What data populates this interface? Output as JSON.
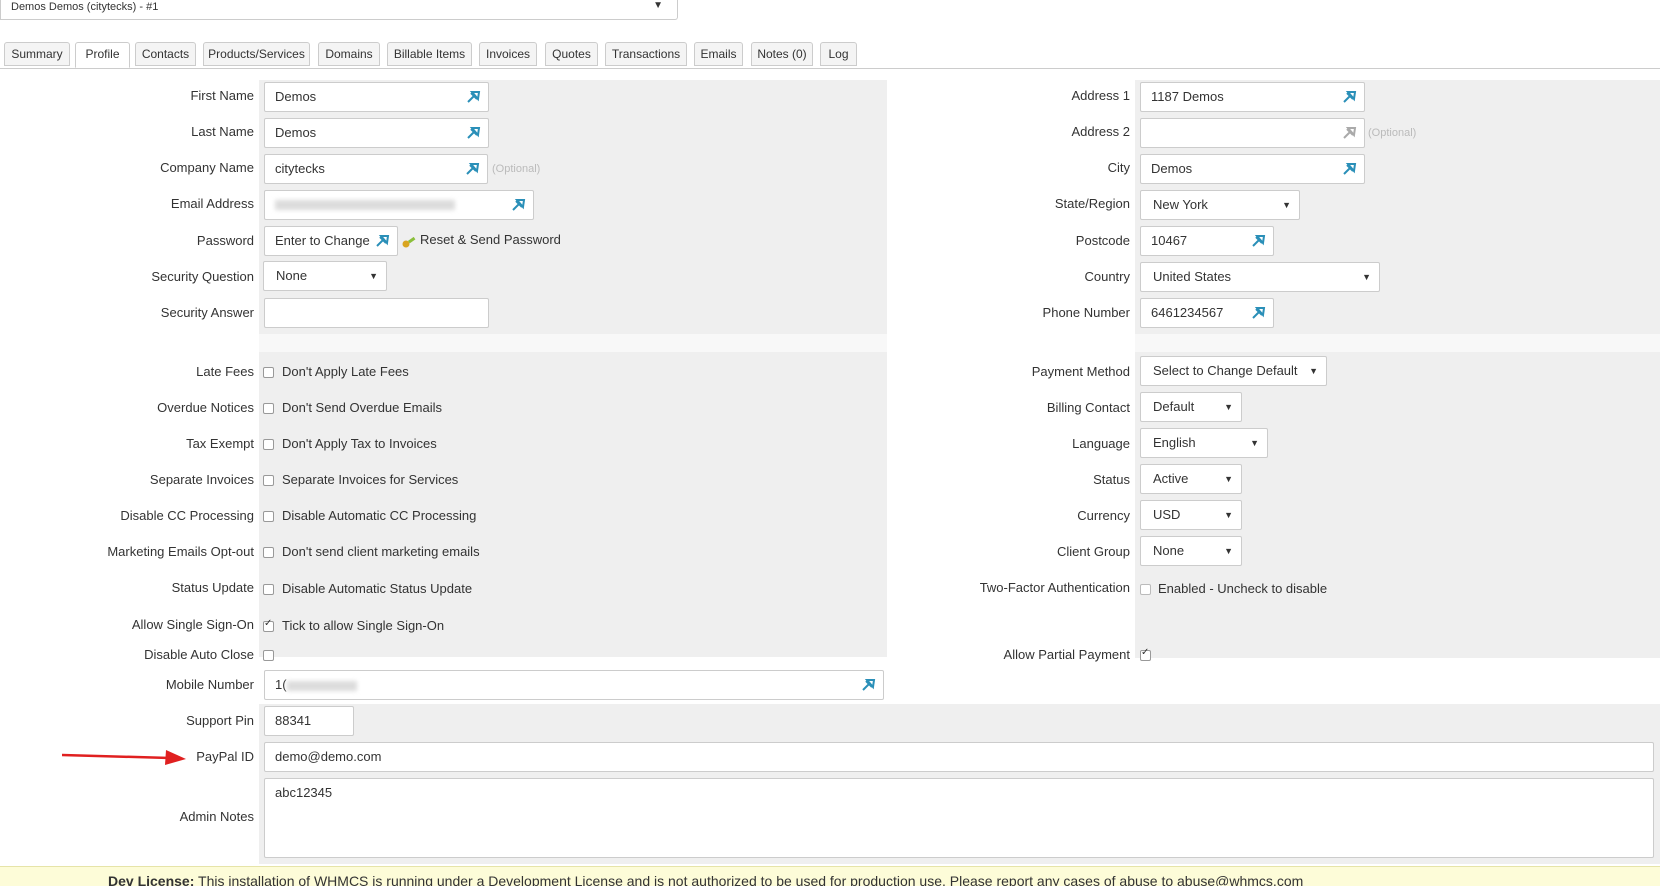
{
  "client_select": {
    "value": "Demos Demos (citytecks) - #1"
  },
  "tabs": [
    "Summary",
    "Profile",
    "Contacts",
    "Products/Services",
    "Domains",
    "Billable Items",
    "Invoices",
    "Quotes",
    "Transactions",
    "Emails",
    "Notes (0)",
    "Log"
  ],
  "active_tab": "Profile",
  "left": {
    "first_name": {
      "label": "First Name",
      "value": "Demos"
    },
    "last_name": {
      "label": "Last Name",
      "value": "Demos"
    },
    "company_name": {
      "label": "Company Name",
      "value": "citytecks",
      "hint": "(Optional)"
    },
    "email": {
      "label": "Email Address",
      "value": ""
    },
    "password": {
      "label": "Password",
      "value": "Enter to Change",
      "reset_label": "Reset & Send Password"
    },
    "security_question": {
      "label": "Security Question",
      "value": "None"
    },
    "security_answer": {
      "label": "Security Answer",
      "value": ""
    },
    "late_fees": {
      "label": "Late Fees",
      "text": "Don't Apply Late Fees",
      "checked": false
    },
    "overdue_notices": {
      "label": "Overdue Notices",
      "text": "Don't Send Overdue Emails",
      "checked": false
    },
    "tax_exempt": {
      "label": "Tax Exempt",
      "text": "Don't Apply Tax to Invoices",
      "checked": false
    },
    "separate_invoices": {
      "label": "Separate Invoices",
      "text": "Separate Invoices for Services",
      "checked": false
    },
    "disable_cc": {
      "label": "Disable CC Processing",
      "text": "Disable Automatic CC Processing",
      "checked": false
    },
    "marketing_optout": {
      "label": "Marketing Emails Opt-out",
      "text": "Don't send client marketing emails",
      "checked": false
    },
    "status_update": {
      "label": "Status Update",
      "text": "Disable Automatic Status Update",
      "checked": false
    },
    "single_sign_on": {
      "label": "Allow Single Sign-On",
      "text": "Tick to allow Single Sign-On",
      "checked": true
    },
    "disable_auto_close": {
      "label": "Disable Auto Close",
      "checked": false
    },
    "mobile_number": {
      "label": "Mobile Number",
      "value": "1("
    },
    "support_pin": {
      "label": "Support Pin",
      "value": "88341"
    },
    "paypal_id": {
      "label": "PayPal ID",
      "value": "demo@demo.com"
    },
    "admin_notes": {
      "label": "Admin Notes",
      "value": "abc12345"
    }
  },
  "right": {
    "address1": {
      "label": "Address 1",
      "value": "1187 Demos"
    },
    "address2": {
      "label": "Address 2",
      "value": "",
      "hint": "(Optional)"
    },
    "city": {
      "label": "City",
      "value": "Demos"
    },
    "state": {
      "label": "State/Region",
      "value": "New York"
    },
    "postcode": {
      "label": "Postcode",
      "value": "10467"
    },
    "country": {
      "label": "Country",
      "value": "United States"
    },
    "phone": {
      "label": "Phone Number",
      "value": "6461234567"
    },
    "payment_method": {
      "label": "Payment Method",
      "value": "Select to Change Default"
    },
    "billing_contact": {
      "label": "Billing Contact",
      "value": "Default"
    },
    "language": {
      "label": "Language",
      "value": "English"
    },
    "status": {
      "label": "Status",
      "value": "Active"
    },
    "currency": {
      "label": "Currency",
      "value": "USD"
    },
    "client_group": {
      "label": "Client Group",
      "value": "None"
    },
    "two_factor": {
      "label": "Two-Factor Authentication",
      "text": "Enabled - Uncheck to disable",
      "checked": false
    },
    "partial_payment": {
      "label": "Allow Partial Payment",
      "checked": true
    }
  },
  "license": {
    "bold": "Dev License:",
    "text": "This installation of WHMCS is running under a Development License and is not authorized to be used for production use. Please report any cases of abuse to abuse@whmcs.com"
  },
  "colors": {
    "pin": "#2a8fb8",
    "arrow": "#e02020",
    "row_gray": "#efefef"
  }
}
